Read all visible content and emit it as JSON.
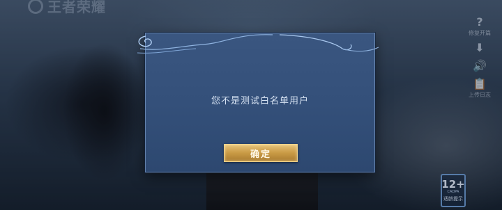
{
  "game": {
    "logo_text": "王者荣耀"
  },
  "side_menu": [
    {
      "icon": "question-icon",
      "glyph": "?",
      "label": "修复开篇"
    },
    {
      "icon": "download-icon",
      "glyph": "⬇",
      "label": ""
    },
    {
      "icon": "speaker-icon",
      "glyph": "🔊",
      "label": ""
    },
    {
      "icon": "clipboard-icon",
      "glyph": "📋",
      "label": "上传日志"
    }
  ],
  "age_rating": {
    "number": "12+",
    "sub": "CADPA",
    "label": "适龄提示"
  },
  "dialog": {
    "message": "您不是测试白名单用户",
    "confirm_label": "确定"
  },
  "colors": {
    "dialog_bg": "#34507a",
    "button_gold": "#c99a45",
    "text_light": "#d6e2f2"
  }
}
